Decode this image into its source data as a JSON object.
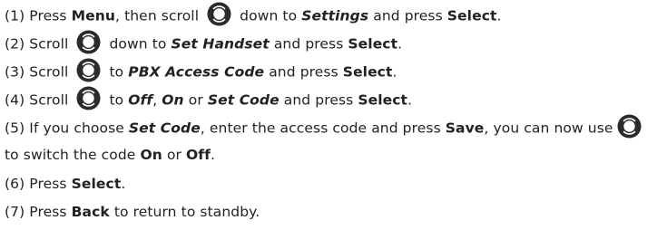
{
  "steps": [
    {
      "num": "(1)",
      "t1": "Press",
      "k1": "Menu",
      "t2": ", then scroll",
      "t3": "down to",
      "k2": "Settings",
      "t4": "and press",
      "k3": "Select",
      "end": "."
    },
    {
      "num": "(2)",
      "t1": "Scroll",
      "t2": "down to",
      "k1": "Set Handset",
      "t3": "and press",
      "k2": "Select",
      "end": "."
    },
    {
      "num": "(3)",
      "t1": "Scroll",
      "t2": "to",
      "k1": "PBX Access Code",
      "t3": "and press",
      "k2": "Select",
      "end": "."
    },
    {
      "num": "(4)",
      "t1": "Scroll",
      "t2": "to",
      "k1": "Off",
      "sep1": ",",
      "k2": "On",
      "t3": "or",
      "k3": "Set Code",
      "t4": "and press",
      "k4": "Select",
      "end": "."
    },
    {
      "num": "(5)",
      "t1": "If you choose",
      "k1": "Set Code",
      "t2": ", enter the access code and press",
      "k2": "Save",
      "t3": ", you can now use",
      "cont1": "to switch the code",
      "k3": "On",
      "cont2": "or",
      "k4": "Off",
      "end": "."
    },
    {
      "num": "(6)",
      "t1": "Press",
      "k1": "Select",
      "end": "."
    },
    {
      "num": "(7)",
      "t1": "Press",
      "k1": "Back",
      "t2": "to return to standby."
    }
  ],
  "icons": {
    "scroll": "scroll-navigation-key-icon"
  },
  "colors": {
    "text": "#222222",
    "icon_fill": "#2b2b2b",
    "icon_highlight": "#ffffff"
  }
}
